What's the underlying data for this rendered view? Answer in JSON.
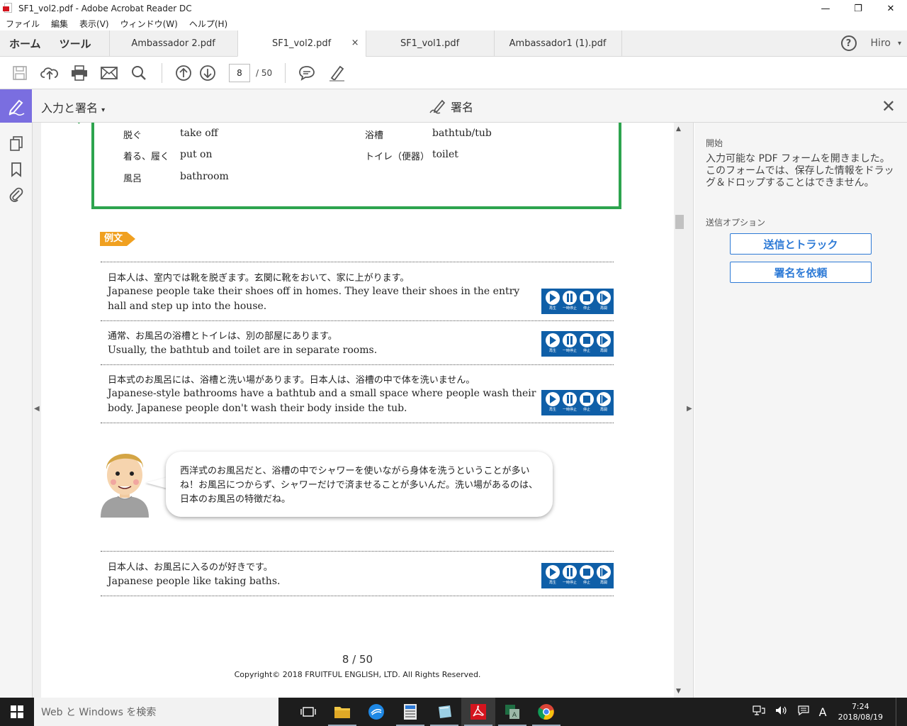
{
  "window": {
    "title": "SF1_vol2.pdf - Adobe Acrobat Reader DC",
    "minimize": "—",
    "restore": "❐",
    "close": "✕"
  },
  "menu": [
    "ファイル",
    "編集",
    "表示(V)",
    "ウィンドウ(W)",
    "ヘルプ(H)"
  ],
  "nav": {
    "home": "ホーム",
    "tools": "ツール"
  },
  "tabs": [
    {
      "label": "Ambassador 2.pdf"
    },
    {
      "label": "SF1_vol2.pdf",
      "close": "×"
    },
    {
      "label": "SF1_vol1.pdf"
    },
    {
      "label": "Ambassador1 (1).pdf"
    }
  ],
  "user": {
    "help": "?",
    "name": "Hiro",
    "caret": "▾"
  },
  "toolbar": {
    "page_current": "8",
    "page_total": "/ 50"
  },
  "fill_sign": {
    "mode_label": "入力と署名",
    "caret": "▾",
    "sign_label": "署名",
    "close": "✕"
  },
  "document": {
    "vocab": [
      {
        "jp": "脱ぐ",
        "en": "take off"
      },
      {
        "jp": "着る、履く",
        "en": "put on"
      },
      {
        "jp": "風呂",
        "en": "bathroom"
      },
      {
        "jp": "浴槽",
        "en": "bathtub/tub"
      },
      {
        "jp": "トイレ（便器）",
        "en": "toilet"
      }
    ],
    "example_label": "例文",
    "examples": [
      {
        "jp": "日本人は、室内では靴を脱ぎます。玄関に靴をおいて、家に上がります。",
        "en": "Japanese people take their shoes off in homes. They leave their shoes in the entry hall and step up into the house."
      },
      {
        "jp": "通常、お風呂の浴槽とトイレは、別の部屋にあります。",
        "en": "Usually, the bathtub and toilet are in separate rooms."
      },
      {
        "jp": "日本式のお風呂には、浴槽と洗い場があります。日本人は、浴槽の中で体を洗いません。",
        "en": "Japanese-style bathrooms have a bathtub and a small space where people wash their body. Japanese people don't wash their body inside the tub."
      },
      {
        "jp": "日本人は、お風呂に入るのが好きです。",
        "en": "Japanese people like taking baths."
      }
    ],
    "player_labels": [
      "再生",
      "一時停止",
      "停止",
      "再開"
    ],
    "speech": "西洋式のお風呂だと、浴槽の中でシャワーを使いながら身体を洗うということが多いね！お風呂につからず、シャワーだけで済ませることが多いんだ。洗い場があるのは、日本のお風呂の特徴だね。",
    "page_number": "8 / 50",
    "copyright": "Copyright© 2018 FRUITFUL ENGLISH, LTD. All Rights Reserved."
  },
  "right_panel": {
    "start_heading": "開始",
    "message": "入力可能な PDF フォームを開きました。このフォームでは、保存した情報をドラッグ＆ドロップすることはできません。",
    "send_heading": "送信オプション",
    "send_track_button": "送信とトラック",
    "request_sign_button": "署名を依頼"
  },
  "taskbar": {
    "search_placeholder": "Web と Windows を検索",
    "ime": "A",
    "time": "7:24",
    "date": "2018/08/19"
  },
  "colors": {
    "accent_purple": "#7a6ee0",
    "green_box": "#2da44e",
    "blue_button": "#2d7ad6",
    "player_blue": "#0f5fa8",
    "orange_label": "#f0a020"
  }
}
